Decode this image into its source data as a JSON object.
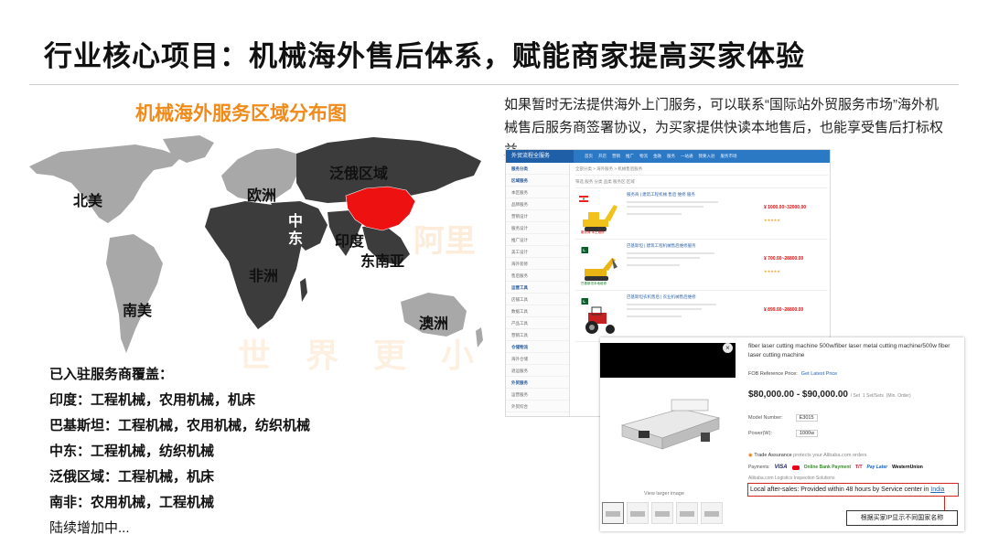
{
  "slide": {
    "title": "行业核心项目：机械海外售后体系，赋能商家提高买家体验"
  },
  "map": {
    "title": "机械海外服务区域分布图",
    "regions": {
      "north_america": "北美",
      "south_america": "南美",
      "europe": "欧洲",
      "russia_region": "泛俄区域",
      "middle_east_1": "中",
      "middle_east_2": "东",
      "india": "印度",
      "africa": "非洲",
      "southeast_asia": "东南亚",
      "australia": "澳洲"
    },
    "watermark": "世 界 更 小",
    "watermark_brand": "阿里",
    "colors": {
      "covered": "#3c3c3c",
      "uncovered": "#a8a8a8",
      "china": "#ee1111",
      "accent": "#f08a1a"
    }
  },
  "coverage": {
    "title": "已入驻服务商覆盖：",
    "items": [
      "印度：工程机械，农用机械，机床",
      "巴基斯坦：工程机械，农用机械，纺织机械",
      "中东：工程机械，纺织机械",
      "泛俄区域：工程机械，机床",
      "南非：农用机械，工程机械"
    ],
    "more": "陆续增加中..."
  },
  "description": "如果暂时无法提供海外上门服务，可以联系“国际站外贸服务市场”海外机械售后服务商签署协议，为买家提供快读本地售后，也能享受售后打标权益。",
  "screenshot1": {
    "header": "外贸流程全服务",
    "nav": [
      "首页",
      "开店",
      "营销",
      "推广",
      "物流",
      "金融",
      "服务",
      "一站通",
      "我要入驻",
      "服务市场"
    ],
    "sidebar": [
      "服务分类",
      "区域服务",
      "本区服务",
      "品牌服务",
      "营销设计",
      "服务设计",
      "推广设计",
      "美工设计",
      "海外装修",
      "售后服务",
      "运营工具",
      "店铺工具",
      "数据工具",
      "产品工具",
      "营销工具",
      "仓储物流",
      "海外仓储",
      "退运服务",
      "外贸服务",
      "运营服务",
      "外贸综合"
    ],
    "breadcrumb": "全部分类 > 海外服务 > 机械售后服务",
    "filter": "筛选  服务  分类  品类  服务区  区域",
    "listings": [
      {
        "title": "服务商 | 建筑工程机械 售后 维修 服务",
        "price": "¥ 1000.00~32000.00",
        "badge": "服务商 本土维修"
      },
      {
        "title": "巴基斯坦 | 建筑工程机械售后维修服务",
        "price": "¥ 700.00~28800.00",
        "badge": "巴基斯坦本地维修"
      },
      {
        "title": "巴基斯坦农机售后 | 农业机械售后维修",
        "price": "¥ 899.00~28800.00",
        "badge": ""
      }
    ]
  },
  "screenshot2": {
    "product_title": "fiber laser cutting machine 500w/fiber laser metal cutting machine/500w fiber laser cutting machine",
    "fob_label": "FOB Reference Price:",
    "fob_link": "Get Latest Price",
    "price": "$80,000.00 - $90,000.00",
    "price_unit": "/ Set",
    "moq": "1 Set/Sets",
    "moq_note": "(Min. Order)",
    "model_label": "Model Number:",
    "model_value": "E3015",
    "power_label": "Power(W):",
    "power_value": "1000w",
    "trade_assurance": "Trade Assurance",
    "trade_assurance_note": "protects your Alibaba.com orders",
    "payments_label": "Payments:",
    "payments": [
      "VISA",
      "Online Bank Payment",
      "T/T",
      "Pay Later",
      "WesternUnion"
    ],
    "logistics": "Alibaba.com Logistics    Inspection Solutions",
    "after_sales_prefix": "Local after-sales: Provided within 48 hours by Service center in ",
    "after_sales_country": "India",
    "view_larger": "View larger image",
    "note": "根据买家IP显示不同国家名称",
    "close_symbol": "×"
  }
}
